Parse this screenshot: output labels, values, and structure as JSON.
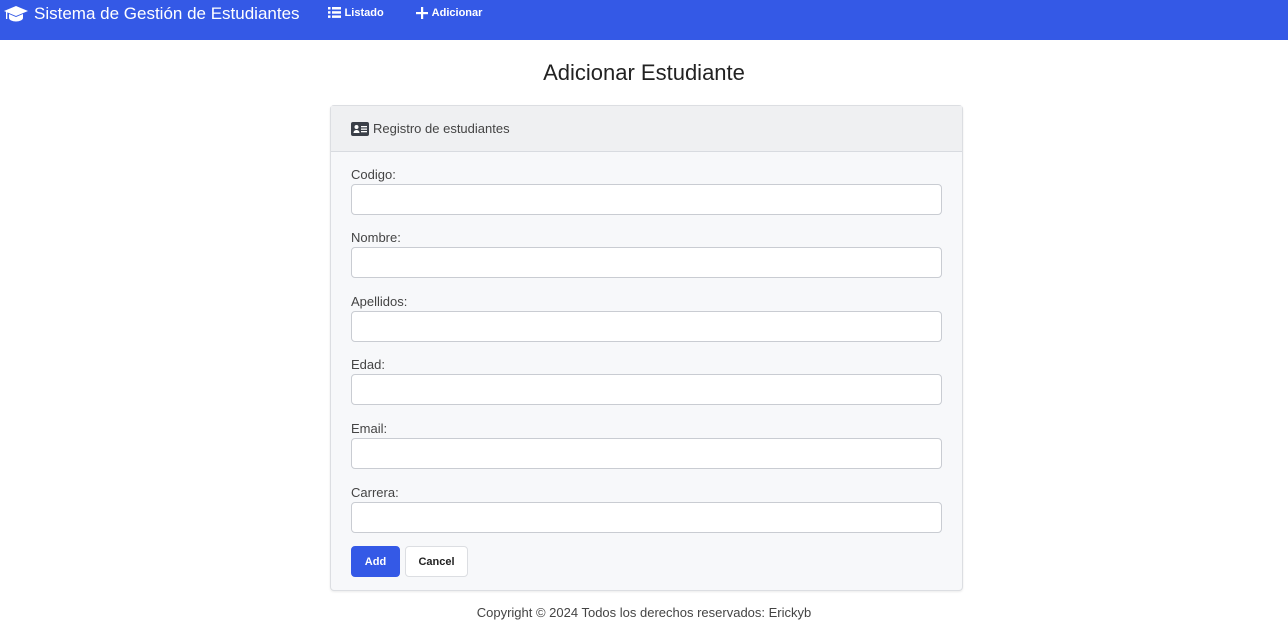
{
  "nav": {
    "brand": "Sistema de Gestión de Estudiantes",
    "links": [
      {
        "label": "Listado",
        "icon": "list-icon"
      },
      {
        "label": "Adicionar",
        "icon": "plus-icon"
      }
    ]
  },
  "page_title": "Adicionar Estudiante",
  "card": {
    "header": "Registro de estudiantes",
    "fields": [
      {
        "label": "Codigo:",
        "value": ""
      },
      {
        "label": "Nombre:",
        "value": ""
      },
      {
        "label": "Apellidos:",
        "value": ""
      },
      {
        "label": "Edad:",
        "value": ""
      },
      {
        "label": "Email:",
        "value": ""
      },
      {
        "label": "Carrera:",
        "value": ""
      }
    ],
    "add_label": "Add",
    "cancel_label": "Cancel"
  },
  "footer": "Copyright © 2024 Todos los derechos reservados: Erickyb",
  "colors": {
    "primary": "#3459e6"
  }
}
